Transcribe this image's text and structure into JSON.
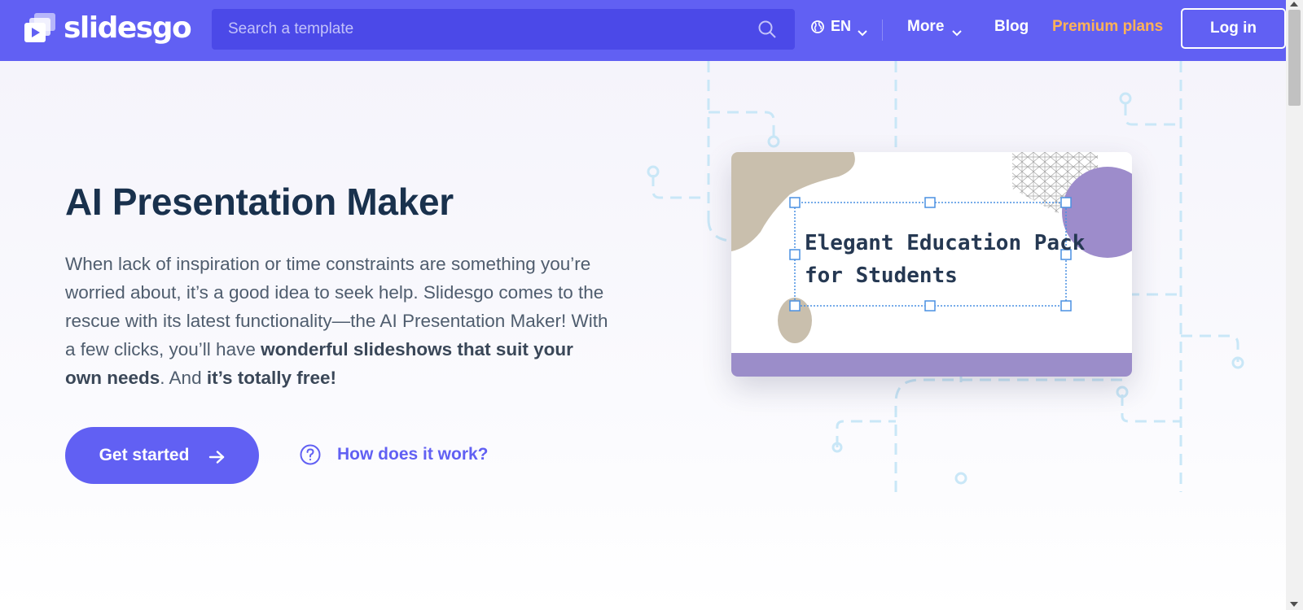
{
  "header": {
    "logo_text": "slidesgo",
    "search_placeholder": "Search a template",
    "language": "EN",
    "more_label": "More",
    "blog_label": "Blog",
    "premium_label": "Premium plans",
    "login_label": "Log in"
  },
  "hero": {
    "title": "AI Presentation Maker",
    "description": {
      "part1": "When lack of inspiration or time constraints are something you’re worried about, it’s a good idea to seek help. Slidesgo comes to the rescue with its latest functionality—the AI Presentation Maker! With a few clicks, you’ll have ",
      "bold1": "wonderful slideshows that suit your own needs",
      "part2": ". And ",
      "bold2": "it’s totally free!"
    },
    "cta_label": "Get started",
    "how_label": "How does it work?"
  },
  "illustration": {
    "slide_title": "Elegant Education Pack\nfor Students"
  },
  "colors": {
    "brand": "#6160f3",
    "search_bg": "#4b49e8",
    "premium": "#ffb258",
    "heading": "#19314d",
    "body_text": "#4f5d6e",
    "circuit": "#c9e7f7",
    "blob_beige": "#c9bfad",
    "blob_purple": "#9d8ccb",
    "slide_bar": "#9b8dc9"
  }
}
